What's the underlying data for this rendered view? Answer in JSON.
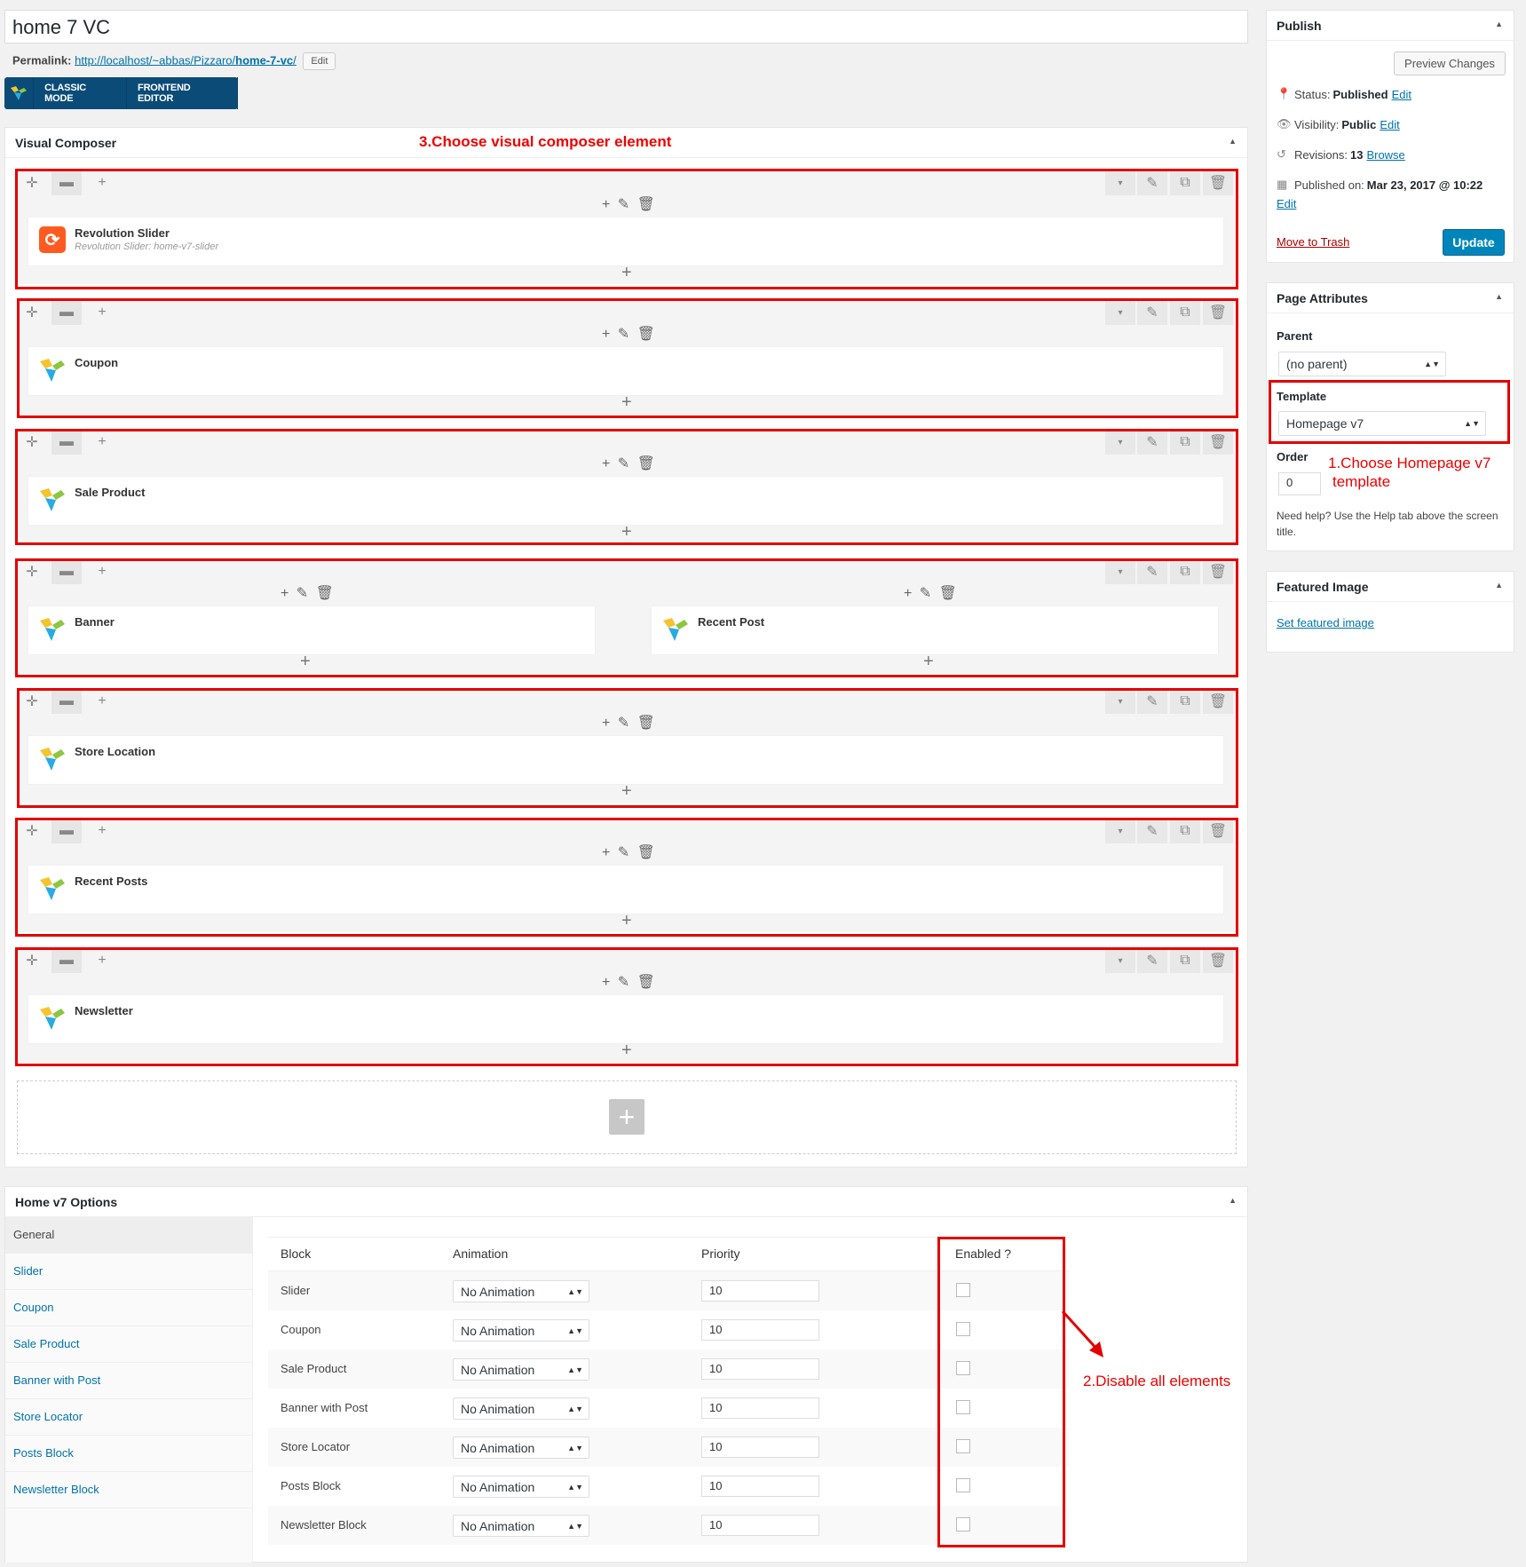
{
  "post": {
    "title": "home 7 VC",
    "permalink_label": "Permalink:",
    "permalink_base": "http://localhost/~abbas/Pizzaro/",
    "permalink_slug": "home-7-vc",
    "permalink_tail": "/",
    "permalink_edit": "Edit"
  },
  "vc_switch": {
    "classic": "CLASSIC MODE",
    "frontend": "FRONTEND EDITOR"
  },
  "vc_box": {
    "title": "Visual Composer",
    "annotation": "3.Choose visual composer element",
    "rows": [
      {
        "columns": [
          {
            "element": "Revolution Slider",
            "sub": "Revolution Slider: home-v7-slider",
            "icon": "revolution-slider-icon"
          }
        ]
      },
      {
        "columns": [
          {
            "element": "Coupon",
            "sub": "",
            "icon": "vc-element-icon"
          }
        ]
      },
      {
        "columns": [
          {
            "element": "Sale Product",
            "sub": "",
            "icon": "vc-element-icon"
          }
        ]
      },
      {
        "columns": [
          {
            "element": "Banner",
            "sub": "",
            "icon": "vc-element-icon"
          },
          {
            "element": "Recent Post",
            "sub": "",
            "icon": "vc-element-icon"
          }
        ]
      },
      {
        "columns": [
          {
            "element": "Store Location",
            "sub": "",
            "icon": "vc-element-icon"
          }
        ]
      },
      {
        "columns": [
          {
            "element": "Recent Posts",
            "sub": "",
            "icon": "vc-element-icon"
          }
        ]
      },
      {
        "columns": [
          {
            "element": "Newsletter",
            "sub": "",
            "icon": "vc-element-icon"
          }
        ]
      }
    ]
  },
  "publish": {
    "title": "Publish",
    "preview": "Preview Changes",
    "status_label": "Status:",
    "status_value": "Published",
    "visibility_label": "Visibility:",
    "visibility_value": "Public",
    "revisions_label": "Revisions:",
    "revisions_value": "13",
    "browse": "Browse",
    "published_label": "Published on:",
    "published_value": "Mar 23, 2017 @ 10:22",
    "edit": "Edit",
    "trash": "Move to Trash",
    "update": "Update"
  },
  "attributes": {
    "title": "Page Attributes",
    "parent_label": "Parent",
    "parent_value": "(no parent)",
    "template_label": "Template",
    "template_value": "Homepage v7",
    "order_label": "Order",
    "order_value": "0",
    "annotation_line1": "1.Choose Homepage v7",
    "annotation_line2": "template",
    "help": "Need help? Use the Help tab above the screen title."
  },
  "featured": {
    "title": "Featured Image",
    "link": "Set featured image"
  },
  "options": {
    "title": "Home v7 Options",
    "tabs": [
      "General",
      "Slider",
      "Coupon",
      "Sale Product",
      "Banner with Post",
      "Store Locator",
      "Posts Block",
      "Newsletter Block"
    ],
    "columns": {
      "block": "Block",
      "animation": "Animation",
      "priority": "Priority",
      "enabled": "Enabled ?"
    },
    "rows": [
      {
        "block": "Slider",
        "animation": "No Animation",
        "priority": "10"
      },
      {
        "block": "Coupon",
        "animation": "No Animation",
        "priority": "10"
      },
      {
        "block": "Sale Product",
        "animation": "No Animation",
        "priority": "10"
      },
      {
        "block": "Banner with Post",
        "animation": "No Animation",
        "priority": "10"
      },
      {
        "block": "Store Locator",
        "animation": "No Animation",
        "priority": "10"
      },
      {
        "block": "Posts Block",
        "animation": "No Animation",
        "priority": "10"
      },
      {
        "block": "Newsletter Block",
        "animation": "No Animation",
        "priority": "10"
      }
    ],
    "annotation": "2.Disable all elements"
  },
  "colors": {
    "annotation": "#e30000",
    "link": "#0073aa",
    "primary": "#0085ba",
    "vc_bar": "#0a4b78"
  }
}
